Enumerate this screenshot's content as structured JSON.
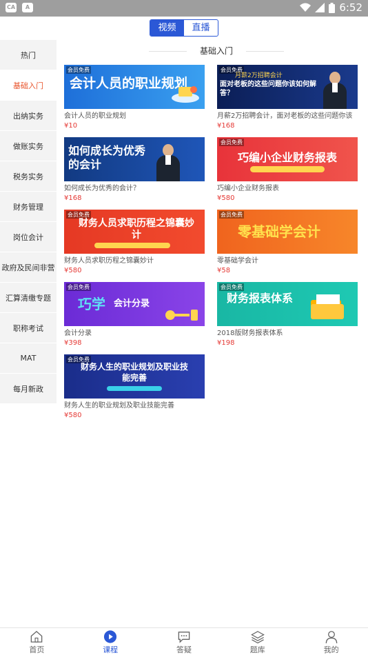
{
  "status_bar": {
    "left_badges": [
      "CA",
      "A"
    ],
    "time": "6:52"
  },
  "toggle": {
    "video": "视频",
    "live": "直播"
  },
  "sidebar": {
    "items": [
      {
        "label": "热门",
        "active": false
      },
      {
        "label": "基础入门",
        "active": true
      },
      {
        "label": "出纳实务",
        "active": false
      },
      {
        "label": "做账实务",
        "active": false
      },
      {
        "label": "税务实务",
        "active": false
      },
      {
        "label": "财务管理",
        "active": false
      },
      {
        "label": "岗位会计",
        "active": false
      },
      {
        "label": "政府及民间非营",
        "active": false
      },
      {
        "label": "汇算清缴专题",
        "active": false
      },
      {
        "label": "职称考试",
        "active": false
      },
      {
        "label": "MAT",
        "active": false
      },
      {
        "label": "每月新政",
        "active": false
      }
    ]
  },
  "section": {
    "title": "基础入门"
  },
  "courses": [
    {
      "badge": "会员免费",
      "banner": "会计人员的职业规划",
      "banner_sub": "",
      "title": "会计人员的职业规划",
      "price": "¥10"
    },
    {
      "badge": "会员免费",
      "banner": "面对老板的这些问题你该如何解答？",
      "banner_sub": "月薪2万招聘会计",
      "title": "月薪2万招聘会计，面对老板的这些问题你该",
      "price": "¥168"
    },
    {
      "badge": "",
      "banner": "如何成长为优秀的会计",
      "banner_sub": "",
      "title": "如何成长为优秀的会计？",
      "price": "¥168"
    },
    {
      "badge": "会员免费",
      "banner": "巧编小企业财务报表",
      "banner_sub": "",
      "title": "巧编小企业财务报表",
      "price": "¥580"
    },
    {
      "badge": "会员免费",
      "banner": "财务人员求职历程之锦囊妙计",
      "banner_sub": "",
      "title": "财务人员求职历程之锦囊妙计",
      "price": "¥580"
    },
    {
      "badge": "会员免费",
      "banner": "零基础学会计",
      "banner_sub": "",
      "title": "零基础学会计",
      "price": "¥58"
    },
    {
      "badge": "会员免费",
      "banner": "会计分录",
      "banner_sub": "巧学",
      "title": "会计分录",
      "price": "¥398"
    },
    {
      "badge": "会员免费",
      "banner": "财务报表体系",
      "banner_sub": "",
      "title": "2018版财务报表体系",
      "price": "¥198"
    },
    {
      "badge": "会员免费",
      "banner": "财务人生的职业规划及职业技能完善",
      "banner_sub": "",
      "title": "财务人生的职业规划及职业技能完善",
      "price": "¥580"
    }
  ],
  "bottom_nav": [
    {
      "label": "首页",
      "icon": "home-icon",
      "active": false
    },
    {
      "label": "课程",
      "icon": "play-icon",
      "active": true
    },
    {
      "label": "答疑",
      "icon": "chat-icon",
      "active": false
    },
    {
      "label": "题库",
      "icon": "layers-icon",
      "active": false
    },
    {
      "label": "我的",
      "icon": "user-icon",
      "active": false
    }
  ],
  "colors": {
    "accent": "#2b58d6",
    "active_sidebar": "#e8542c",
    "price": "#e53935"
  }
}
